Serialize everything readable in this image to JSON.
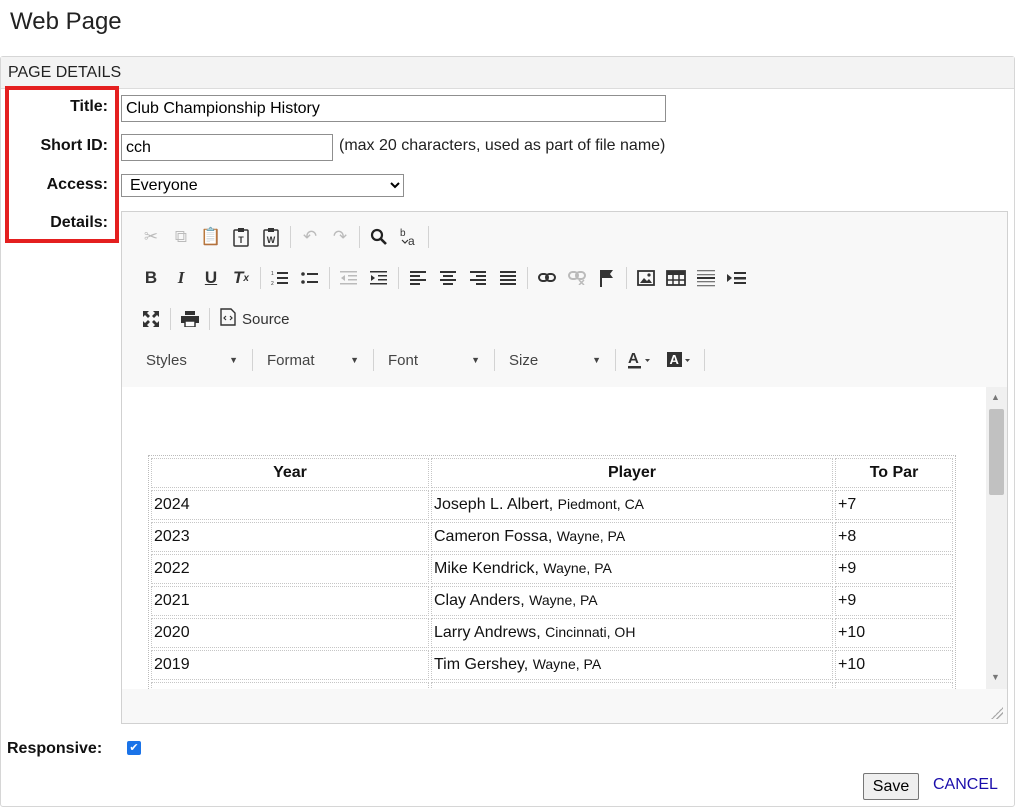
{
  "page": {
    "title": "Web Page"
  },
  "panel": {
    "header": "PAGE DETAILS"
  },
  "form": {
    "title_label": "Title:",
    "title_value": "Club Championship History",
    "short_id_label": "Short ID:",
    "short_id_value": "cch",
    "short_id_hint": "(max 20 characters, used as part of file name)",
    "access_label": "Access:",
    "access_selected": "Everyone",
    "details_label": "Details:",
    "responsive_label": "Responsive:",
    "responsive_checked": true
  },
  "editor": {
    "source_label": "Source",
    "combos": {
      "styles": "Styles",
      "format": "Format",
      "font": "Font",
      "size": "Size"
    },
    "table": {
      "headers": [
        "Year",
        "Player",
        "To Par"
      ],
      "rows": [
        {
          "year": "2024",
          "player": "Joseph L. Albert,",
          "location": "Piedmont, CA",
          "to_par": "+7"
        },
        {
          "year": "2023",
          "player": "Cameron Fossa,",
          "location": "Wayne, PA",
          "to_par": "+8"
        },
        {
          "year": "2022",
          "player": "Mike Kendrick,",
          "location": "Wayne, PA",
          "to_par": "+9"
        },
        {
          "year": "2021",
          "player": "Clay Anders,",
          "location": "Wayne, PA",
          "to_par": "+9"
        },
        {
          "year": "2020",
          "player": "Larry Andrews,",
          "location": "Cincinnati, OH",
          "to_par": "+10"
        },
        {
          "year": "2019",
          "player": "Tim Gershey,",
          "location": "Wayne, PA",
          "to_par": "+10"
        }
      ]
    }
  },
  "actions": {
    "save": "Save",
    "cancel": "CANCEL"
  },
  "colors": {
    "highlight": "#e41f1f",
    "link": "#1a0dab",
    "checkbox": "#1a73e8"
  }
}
